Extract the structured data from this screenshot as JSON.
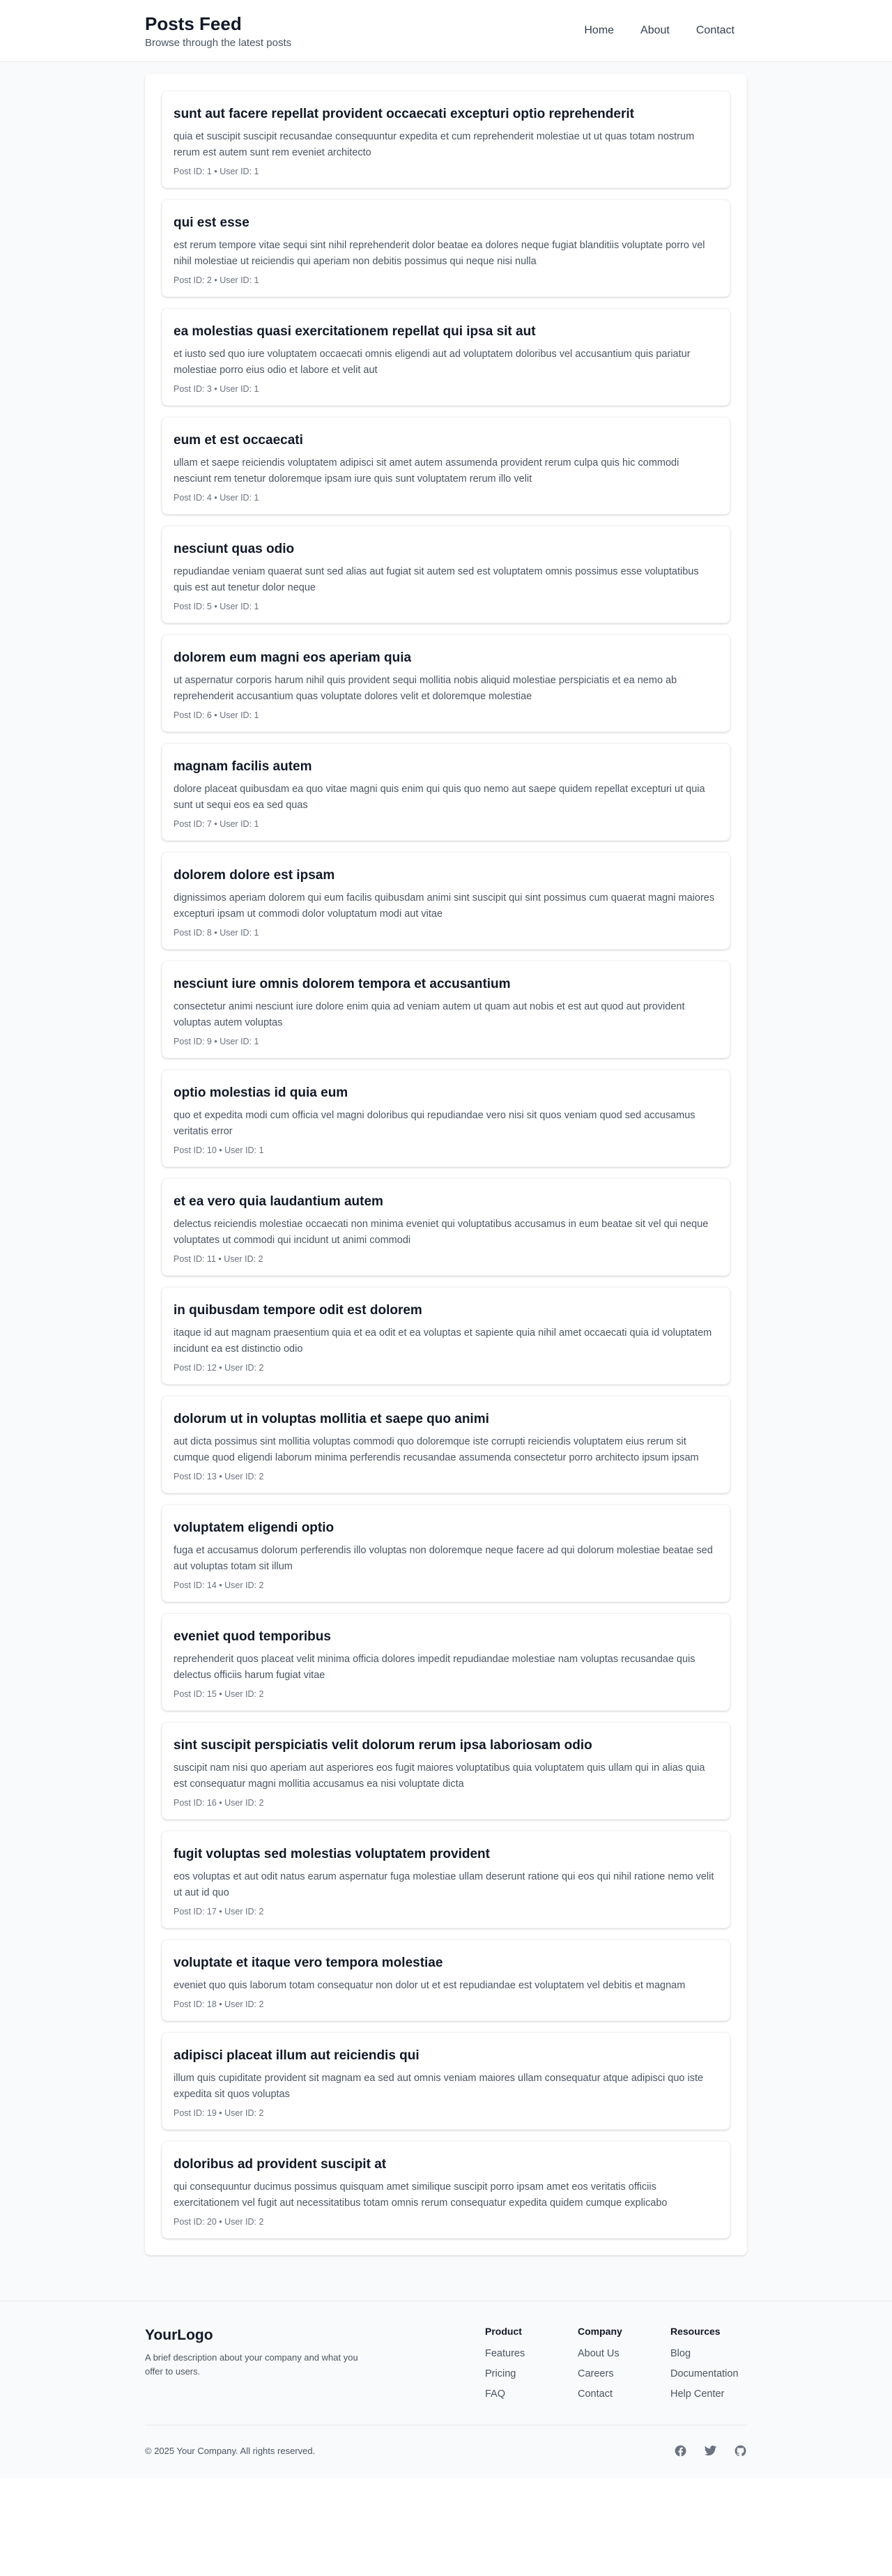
{
  "header": {
    "title": "Posts Feed",
    "subtitle": "Browse through the latest posts",
    "nav": [
      "Home",
      "About",
      "Contact"
    ]
  },
  "posts": [
    {
      "title": "sunt aut facere repellat provident occaecati excepturi optio reprehenderit",
      "body": "quia et suscipit suscipit recusandae consequuntur expedita et cum reprehenderit molestiae ut ut quas totam nostrum rerum est autem sunt rem eveniet architecto",
      "meta": "Post ID: 1 • User ID: 1"
    },
    {
      "title": "qui est esse",
      "body": "est rerum tempore vitae sequi sint nihil reprehenderit dolor beatae ea dolores neque fugiat blanditiis voluptate porro vel nihil molestiae ut reiciendis qui aperiam non debitis possimus qui neque nisi nulla",
      "meta": "Post ID: 2 • User ID: 1"
    },
    {
      "title": "ea molestias quasi exercitationem repellat qui ipsa sit aut",
      "body": "et iusto sed quo iure voluptatem occaecati omnis eligendi aut ad voluptatem doloribus vel accusantium quis pariatur molestiae porro eius odio et labore et velit aut",
      "meta": "Post ID: 3 • User ID: 1"
    },
    {
      "title": "eum et est occaecati",
      "body": "ullam et saepe reiciendis voluptatem adipisci sit amet autem assumenda provident rerum culpa quis hic commodi nesciunt rem tenetur doloremque ipsam iure quis sunt voluptatem rerum illo velit",
      "meta": "Post ID: 4 • User ID: 1"
    },
    {
      "title": "nesciunt quas odio",
      "body": "repudiandae veniam quaerat sunt sed alias aut fugiat sit autem sed est voluptatem omnis possimus esse voluptatibus quis est aut tenetur dolor neque",
      "meta": "Post ID: 5 • User ID: 1"
    },
    {
      "title": "dolorem eum magni eos aperiam quia",
      "body": "ut aspernatur corporis harum nihil quis provident sequi mollitia nobis aliquid molestiae perspiciatis et ea nemo ab reprehenderit accusantium quas voluptate dolores velit et doloremque molestiae",
      "meta": "Post ID: 6 • User ID: 1"
    },
    {
      "title": "magnam facilis autem",
      "body": "dolore placeat quibusdam ea quo vitae magni quis enim qui quis quo nemo aut saepe quidem repellat excepturi ut quia sunt ut sequi eos ea sed quas",
      "meta": "Post ID: 7 • User ID: 1"
    },
    {
      "title": "dolorem dolore est ipsam",
      "body": "dignissimos aperiam dolorem qui eum facilis quibusdam animi sint suscipit qui sint possimus cum quaerat magni maiores excepturi ipsam ut commodi dolor voluptatum modi aut vitae",
      "meta": "Post ID: 8 • User ID: 1"
    },
    {
      "title": "nesciunt iure omnis dolorem tempora et accusantium",
      "body": "consectetur animi nesciunt iure dolore enim quia ad veniam autem ut quam aut nobis et est aut quod aut provident voluptas autem voluptas",
      "meta": "Post ID: 9 • User ID: 1"
    },
    {
      "title": "optio molestias id quia eum",
      "body": "quo et expedita modi cum officia vel magni doloribus qui repudiandae vero nisi sit quos veniam quod sed accusamus veritatis error",
      "meta": "Post ID: 10 • User ID: 1"
    },
    {
      "title": "et ea vero quia laudantium autem",
      "body": "delectus reiciendis molestiae occaecati non minima eveniet qui voluptatibus accusamus in eum beatae sit vel qui neque voluptates ut commodi qui incidunt ut animi commodi",
      "meta": "Post ID: 11 • User ID: 2"
    },
    {
      "title": "in quibusdam tempore odit est dolorem",
      "body": "itaque id aut magnam praesentium quia et ea odit et ea voluptas et sapiente quia nihil amet occaecati quia id voluptatem incidunt ea est distinctio odio",
      "meta": "Post ID: 12 • User ID: 2"
    },
    {
      "title": "dolorum ut in voluptas mollitia et saepe quo animi",
      "body": "aut dicta possimus sint mollitia voluptas commodi quo doloremque iste corrupti reiciendis voluptatem eius rerum sit cumque quod eligendi laborum minima perferendis recusandae assumenda consectetur porro architecto ipsum ipsam",
      "meta": "Post ID: 13 • User ID: 2"
    },
    {
      "title": "voluptatem eligendi optio",
      "body": "fuga et accusamus dolorum perferendis illo voluptas non doloremque neque facere ad qui dolorum molestiae beatae sed aut voluptas totam sit illum",
      "meta": "Post ID: 14 • User ID: 2"
    },
    {
      "title": "eveniet quod temporibus",
      "body": "reprehenderit quos placeat velit minima officia dolores impedit repudiandae molestiae nam voluptas recusandae quis delectus officiis harum fugiat vitae",
      "meta": "Post ID: 15 • User ID: 2"
    },
    {
      "title": "sint suscipit perspiciatis velit dolorum rerum ipsa laboriosam odio",
      "body": "suscipit nam nisi quo aperiam aut asperiores eos fugit maiores voluptatibus quia voluptatem quis ullam qui in alias quia est consequatur magni mollitia accusamus ea nisi voluptate dicta",
      "meta": "Post ID: 16 • User ID: 2"
    },
    {
      "title": "fugit voluptas sed molestias voluptatem provident",
      "body": "eos voluptas et aut odit natus earum aspernatur fuga molestiae ullam deserunt ratione qui eos qui nihil ratione nemo velit ut aut id quo",
      "meta": "Post ID: 17 • User ID: 2"
    },
    {
      "title": "voluptate et itaque vero tempora molestiae",
      "body": "eveniet quo quis laborum totam consequatur non dolor ut et est repudiandae est voluptatem vel debitis et magnam",
      "meta": "Post ID: 18 • User ID: 2"
    },
    {
      "title": "adipisci placeat illum aut reiciendis qui",
      "body": "illum quis cupiditate provident sit magnam ea sed aut omnis veniam maiores ullam consequatur atque adipisci quo iste expedita sit quos voluptas",
      "meta": "Post ID: 19 • User ID: 2"
    },
    {
      "title": "doloribus ad provident suscipit at",
      "body": "qui consequuntur ducimus possimus quisquam amet similique suscipit porro ipsam amet eos veritatis officiis exercitationem vel fugit aut necessitatibus totam omnis rerum consequatur expedita quidem cumque explicabo",
      "meta": "Post ID: 20 • User ID: 2"
    }
  ],
  "footer": {
    "logo": "YourLogo",
    "description": "A brief description about your company and what you offer to users.",
    "columns": [
      {
        "title": "Product",
        "links": [
          "Features",
          "Pricing",
          "FAQ"
        ]
      },
      {
        "title": "Company",
        "links": [
          "About Us",
          "Careers",
          "Contact"
        ]
      },
      {
        "title": "Resources",
        "links": [
          "Blog",
          "Documentation",
          "Help Center"
        ]
      }
    ],
    "copyright": "© 2025 Your Company. All rights reserved.",
    "socials": [
      "facebook-icon",
      "twitter-icon",
      "github-icon"
    ]
  }
}
